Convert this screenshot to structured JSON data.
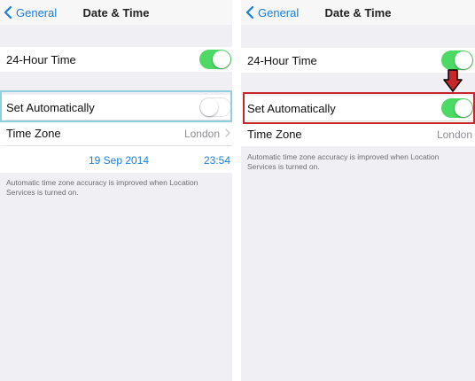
{
  "left_screen": {
    "nav": {
      "back_label": "General",
      "title": "Date & Time"
    },
    "rows": {
      "hour24": {
        "label": "24-Hour Time",
        "switch_on": true
      },
      "set_auto": {
        "label": "Set Automatically",
        "switch_on": false
      },
      "time_zone": {
        "label": "Time Zone",
        "value": "London"
      },
      "date_time": {
        "date": "19 Sep 2014",
        "time": "23:54"
      }
    },
    "footnote": "Automatic time zone accuracy is improved when Location Services is turned on."
  },
  "right_screen": {
    "nav": {
      "back_label": "General",
      "title": "Date & Time"
    },
    "rows": {
      "hour24": {
        "label": "24-Hour Time",
        "switch_on": true
      },
      "set_auto": {
        "label": "Set Automatically",
        "switch_on": true
      },
      "time_zone": {
        "label": "Time Zone",
        "value": "London"
      }
    },
    "footnote": "Automatic time zone accuracy is improved when Location Services is turned on."
  },
  "colors": {
    "ios_blue": "#1a7fe0",
    "switch_green": "#4cd964",
    "highlight_blue": "#8fcfe0",
    "highlight_red": "#c8262b",
    "background_gray": "#efeff4"
  },
  "icons": [
    "chevron-left-icon",
    "chevron-right-icon",
    "down-arrow-icon"
  ]
}
